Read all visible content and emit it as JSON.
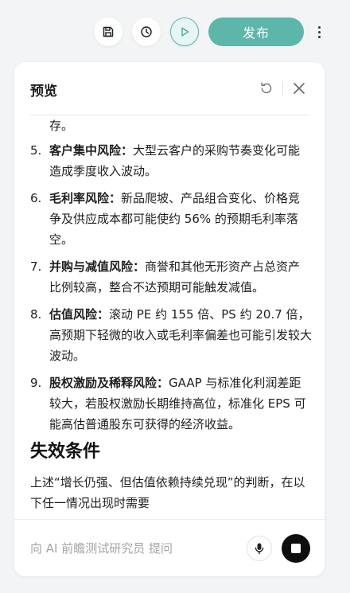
{
  "toolbar": {
    "save_icon": "save-icon",
    "history_icon": "history-icon",
    "run_icon": "play-icon",
    "publish_label": "发布",
    "more_icon": "more-vertical-icon"
  },
  "preview": {
    "title": "预览",
    "refresh_icon": "refresh-icon",
    "close_icon": "close-icon",
    "continued_text": "存。",
    "risks": [
      {
        "num": "5.",
        "title": "客户集中风险",
        "colon": "：",
        "body": "大型云客户的采购节奏变化可能造成季度收入波动。"
      },
      {
        "num": "6.",
        "title": "毛利率风险",
        "colon": "：",
        "body": "新品爬坡、产品组合变化、价格竞争及供应成本都可能使约 56% 的预期毛利率落空。"
      },
      {
        "num": "7.",
        "title": "并购与减值风险",
        "colon": "：",
        "body": "商誉和其他无形资产占总资产比例较高，整合不达预期可能触发减值。"
      },
      {
        "num": "8.",
        "title": "估值风险",
        "colon": "：",
        "body": "滚动 PE 约 155 倍、PS 约 20.7 倍，高预期下轻微的收入或毛利率偏差也可能引发较大波动。"
      },
      {
        "num": "9.",
        "title": "股权激励及稀释风险",
        "colon": "：",
        "body": "GAAP 与标准化利润差距较大，若股权激励长期维持高位，标准化 EPS 可能高估普通股东可获得的经济收益。"
      }
    ],
    "section_heading": "失效条件",
    "section_paragraph": "上述“增长仍强、但估值依赖持续兑现”的判断，在以下任一情况出现时需要"
  },
  "input": {
    "placeholder": "向 AI 前瞻测试研究员 提问",
    "value": "",
    "mic_icon": "microphone-icon",
    "stop_icon": "stop-icon"
  },
  "colors": {
    "accent": "#5cb6aa",
    "page_bg": "#f2f4f5",
    "panel_bg": "#ffffff",
    "stop_btn": "#0e0e0e"
  }
}
